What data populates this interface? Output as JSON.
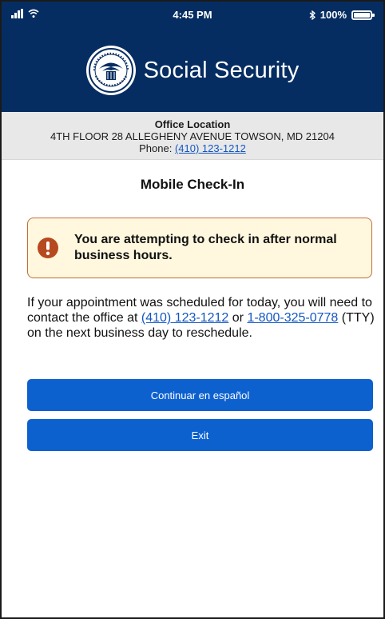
{
  "status_bar": {
    "time": "4:45 PM",
    "battery": "100%",
    "battery_level_percent": 100,
    "icons": [
      "signal-icon",
      "wifi-icon",
      "bluetooth-icon",
      "battery-icon"
    ]
  },
  "header": {
    "title": "Social Security",
    "logo_icon": "ssa-seal-icon",
    "background": "#062d61"
  },
  "office": {
    "heading": "Office Location",
    "address": "4TH FLOOR 28 ALLEGHENY AVENUE TOWSON, MD 21204",
    "phone_label": "Phone:",
    "phone": "(410) 123-1212"
  },
  "page": {
    "title": "Mobile Check-In"
  },
  "alert": {
    "icon": "exclamation-icon",
    "text": "You are attempting to check in after normal business hours.",
    "background": "#fff8de",
    "border": "#c36b3b"
  },
  "message": {
    "part1": "If your appointment was scheduled for today, you will need to contact the office at ",
    "phone": "(410) 123-1212",
    "part2": " or ",
    "tty_phone": "1-800-325-0778",
    "part3": " (TTY) on the next business day to reschedule."
  },
  "buttons": {
    "spanish_label": "Continuar en español",
    "exit_label": "Exit",
    "color": "#0d61cf"
  }
}
